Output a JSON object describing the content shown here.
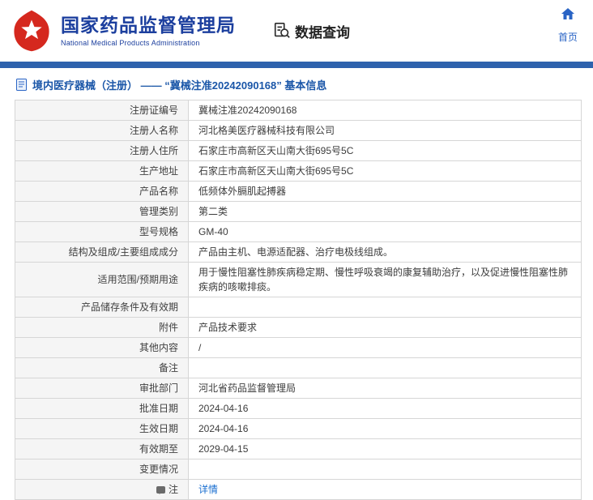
{
  "colors": {
    "brand_blue": "#1c3f9e",
    "strip_blue": "#2e62ad",
    "title_blue": "#1a56a8",
    "link_blue": "#1a6fd0",
    "label_bg": "#f5f5f5",
    "logo_red": "#d5281e"
  },
  "icons": {
    "logo": "nmpa-emblem",
    "section": "document-magnifier",
    "home": "house",
    "title": "document-page",
    "note": "speech-bubble"
  },
  "header": {
    "org_name_cn": "国家药品监督管理局",
    "org_name_en": "National Medical Products Administration",
    "section_title": "数据查询",
    "home_label": "首页"
  },
  "page": {
    "title": "境内医疗器械（注册） ——  “冀械注准20242090168” 基本信息"
  },
  "table": {
    "rows": [
      {
        "label": "注册证编号",
        "value": "冀械注准20242090168"
      },
      {
        "label": "注册人名称",
        "value": "河北格美医疗器械科技有限公司"
      },
      {
        "label": "注册人住所",
        "value": "石家庄市高新区天山南大街695号5C"
      },
      {
        "label": "生产地址",
        "value": "石家庄市高新区天山南大街695号5C"
      },
      {
        "label": "产品名称",
        "value": "低频体外膈肌起搏器"
      },
      {
        "label": "管理类别",
        "value": "第二类"
      },
      {
        "label": "型号规格",
        "value": "GM-40"
      },
      {
        "label": "结构及组成/主要组成成分",
        "value": "产品由主机、电源适配器、治疗电极线组成。"
      },
      {
        "label": "适用范围/预期用途",
        "value": "用于慢性阻塞性肺疾病稳定期、慢性呼吸衰竭的康复辅助治疗，以及促进慢性阻塞性肺疾病的咳嗽排痰。"
      },
      {
        "label": "产品储存条件及有效期",
        "value": ""
      },
      {
        "label": "附件",
        "value": "产品技术要求"
      },
      {
        "label": "其他内容",
        "value": "/"
      },
      {
        "label": "备注",
        "value": ""
      },
      {
        "label": "审批部门",
        "value": "河北省药品监督管理局"
      },
      {
        "label": "批准日期",
        "value": "2024-04-16"
      },
      {
        "label": "生效日期",
        "value": "2024-04-16"
      },
      {
        "label": "有效期至",
        "value": "2029-04-15"
      },
      {
        "label": "变更情况",
        "value": ""
      },
      {
        "label": "注",
        "value": "详情",
        "link": true,
        "icon": "note"
      }
    ]
  }
}
